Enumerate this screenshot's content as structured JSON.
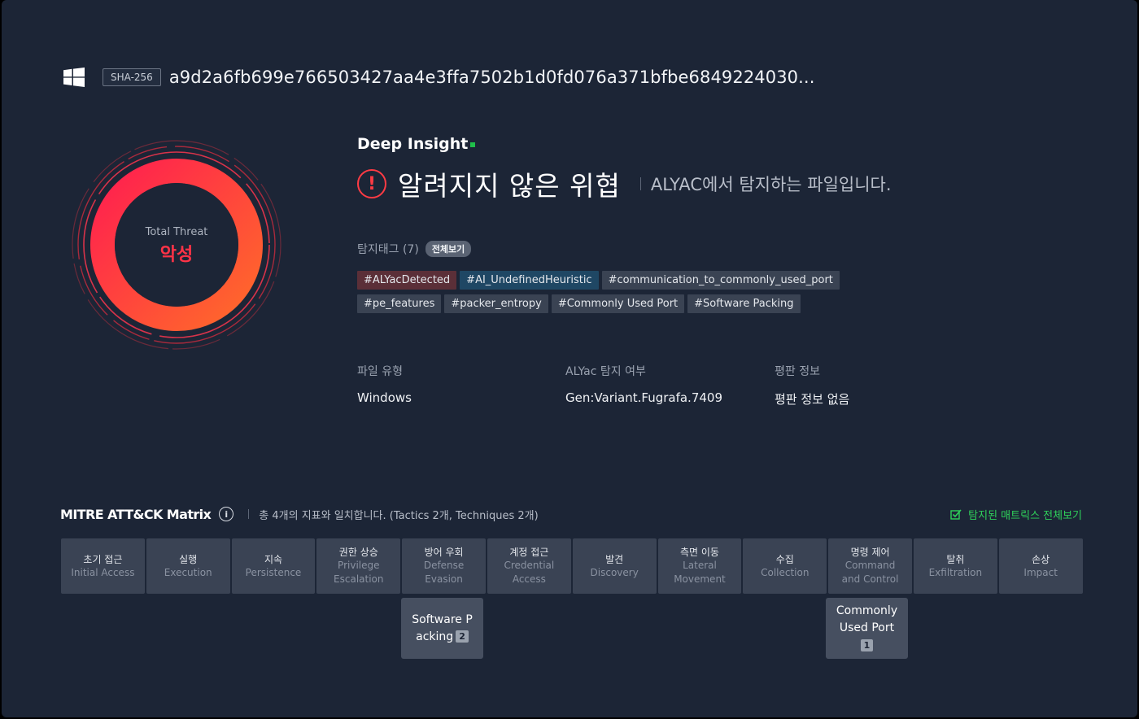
{
  "header": {
    "os_icon": "windows-icon",
    "hash_type": "SHA-256",
    "hash_value": "a9d2a6fb699e766503427aa4e3ffa7502b1d0fd076a371bfbe6849224030..."
  },
  "threat": {
    "ring_label": "Total Threat",
    "level": "악성"
  },
  "insight": {
    "title": "Deep Insight",
    "verdict": "알려지지 않은 위협",
    "description": "ALYAC에서 탐지하는 파일입니다."
  },
  "tags": {
    "label": "탐지태그 (7)",
    "view_all": "전체보기",
    "items": [
      {
        "text": "#ALYacDetected",
        "style": "red"
      },
      {
        "text": "#AI_UndefinedHeuristic",
        "style": "blue"
      },
      {
        "text": "#communication_to_commonly_used_port",
        "style": "gray"
      },
      {
        "text": "#pe_features",
        "style": "gray"
      },
      {
        "text": "#packer_entropy",
        "style": "gray"
      },
      {
        "text": "#Commonly Used Port",
        "style": "gray"
      },
      {
        "text": "#Software Packing",
        "style": "gray"
      }
    ]
  },
  "file_info": {
    "type_label": "파일 유형",
    "type_value": "Windows",
    "detect_label": "ALYac 탐지 여부",
    "detect_value": "Gen:Variant.Fugrafa.7409",
    "rep_label": "평판 정보",
    "rep_value": "평판 정보 없음"
  },
  "matrix": {
    "title": "MITRE ATT&CK Matrix",
    "description": "총 4개의 지표와 일치합니다. (Tactics 2개, Techniques 2개)",
    "view_all": "탐지된 매트릭스 전체보기",
    "tactics": [
      {
        "ko": "초기 접근",
        "en": "Initial Access"
      },
      {
        "ko": "실행",
        "en": "Execution"
      },
      {
        "ko": "지속",
        "en": "Persistence"
      },
      {
        "ko": "권한 상승",
        "en": "Privilege Escalation"
      },
      {
        "ko": "방어 우회",
        "en": "Defense Evasion"
      },
      {
        "ko": "계정 접근",
        "en": "Credential Access"
      },
      {
        "ko": "발견",
        "en": "Discovery"
      },
      {
        "ko": "측면 이동",
        "en": "Lateral Movement"
      },
      {
        "ko": "수집",
        "en": "Collection"
      },
      {
        "ko": "명령 제어",
        "en": "Command and Control"
      },
      {
        "ko": "탈취",
        "en": "Exfiltration"
      },
      {
        "ko": "손상",
        "en": "Impact"
      }
    ],
    "techniques": [
      {
        "line1": "Software P",
        "line2": "acking",
        "count": "2"
      },
      {
        "line1": "Commonly",
        "line2": "Used Port",
        "count": "1"
      }
    ]
  },
  "colors": {
    "background": "#1c2536",
    "danger": "#ff3347",
    "accent_green": "#2fd15a"
  }
}
